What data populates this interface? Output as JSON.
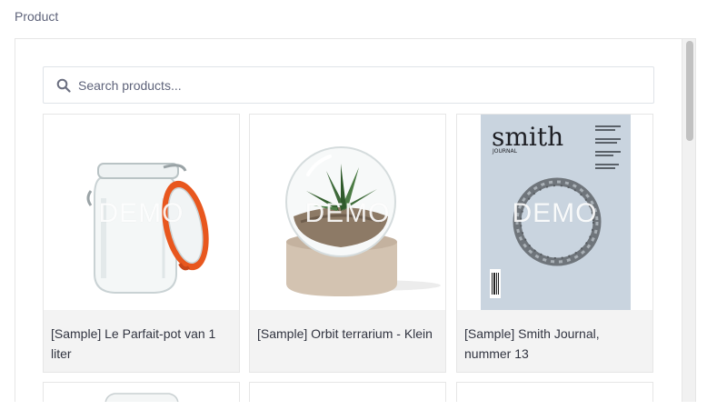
{
  "field": {
    "label": "Product"
  },
  "search": {
    "placeholder": "Search products..."
  },
  "products": [
    {
      "name": "[Sample] Le Parfait-pot van 1 liter",
      "watermark": "DEMO",
      "icon": "glass-jar-image"
    },
    {
      "name": "[Sample] Orbit terrarium - Klein",
      "watermark": "DEMO",
      "icon": "terrarium-image"
    },
    {
      "name": "[Sample] Smith Journal, nummer 13",
      "watermark": "DEMO",
      "icon": "magazine-cover-image",
      "cover": {
        "title": "smith",
        "subtitle": "JOURNAL"
      }
    }
  ],
  "colors": {
    "caption_bg": "#f3f3f3",
    "border": "#e6e6e6",
    "jar_seal": "#e8571e",
    "magazine_bg": "#c9d4df"
  }
}
